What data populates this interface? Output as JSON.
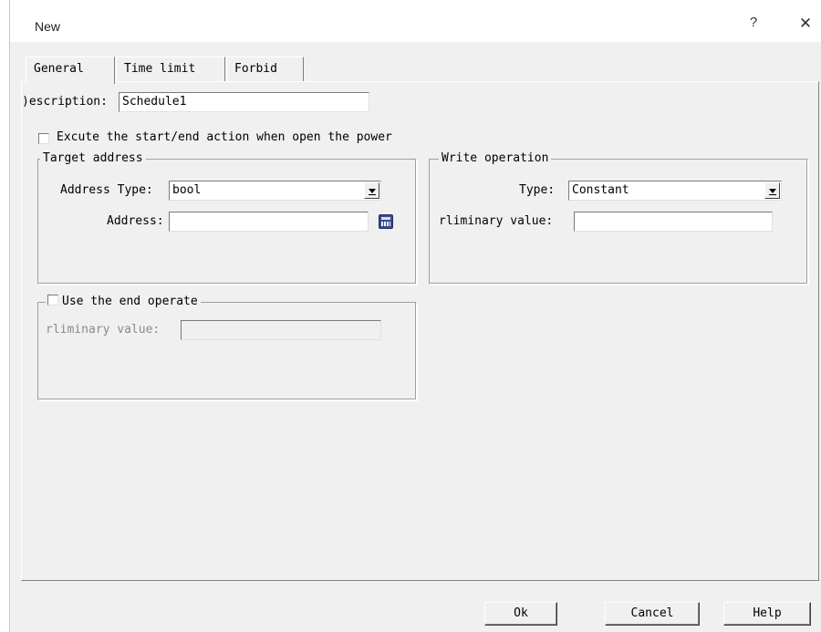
{
  "window": {
    "title": "New",
    "help_glyph": "?",
    "close_glyph": "✕"
  },
  "tabs": [
    {
      "label": "General",
      "active": true
    },
    {
      "label": "Time limit",
      "active": false
    },
    {
      "label": "Forbid",
      "active": false
    }
  ],
  "general": {
    "description_label": ")escription:",
    "description_value": "Schedule1",
    "power_checkbox_label": "Excute the start/end action when open the power",
    "power_checked": false,
    "target_address": {
      "title": "Target address",
      "address_type_label": "Address Type:",
      "address_type_value": "bool",
      "address_label": "Address:",
      "address_value": "",
      "address_picker_icon": "calculator-icon"
    },
    "write_operation": {
      "title": "Write operation",
      "type_label": "Type:",
      "type_value": "Constant",
      "preliminary_label": "rliminary value:",
      "preliminary_value": ""
    },
    "end_operate": {
      "checkbox_label": "Use the end operate",
      "checked": false,
      "preliminary_label": "rliminary value:",
      "preliminary_value": ""
    }
  },
  "buttons": {
    "ok": "Ok",
    "cancel": "Cancel",
    "help": "Help"
  }
}
